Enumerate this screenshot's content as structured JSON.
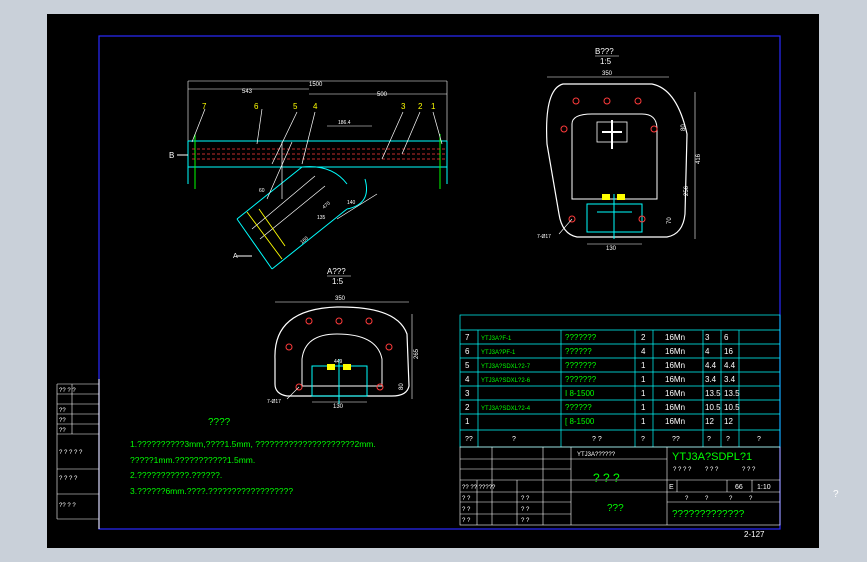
{
  "view_b": {
    "title": "B???",
    "scale": "1:5"
  },
  "view_a": {
    "title": "A???",
    "scale": "1:5"
  },
  "side_view": {
    "dims": {
      "d1500": "1500",
      "d543": "543",
      "d500": "500",
      "d186": "186.4",
      "d470": "470",
      "d135": "135",
      "d160": "160",
      "d140": "140",
      "d60": "60"
    },
    "callouts": [
      "7",
      "6",
      "5",
      "4",
      "3",
      "2",
      "1"
    ],
    "marker_b": "B",
    "marker_a": "A"
  },
  "b_view_dims": {
    "w350": "350",
    "h80": "80",
    "h416": "416",
    "h256": "256",
    "h70": "70",
    "w130": "130",
    "holes": "7-Ø17"
  },
  "a_view_dims": {
    "w350": "350",
    "h265": "265",
    "h80": "80",
    "w130": "130",
    "w449": "449",
    "holes": "7-Ø17"
  },
  "notes": {
    "title": "????",
    "lines": [
      "1.??????????3mm,????1.5mm,    ?????????????????????2mm.",
      "  ?????1mm.???????????1.5mm.",
      "2.???????????.??????.",
      "3.??????6mm.????.??????????????????"
    ]
  },
  "left_strip": [
    "?? ? ?",
    "??",
    "??",
    "??",
    "? ? ? ? ?",
    "? ? ? ?",
    "?? ? ?"
  ],
  "bom": {
    "rows": [
      {
        "no": "7",
        "code": "YTJ3A?F-1",
        "name": "???????",
        "qty": "2",
        "mat": "16Mn",
        "w1": "3",
        "w2": "6"
      },
      {
        "no": "6",
        "code": "YTJ3A?PF-1",
        "name": "??????",
        "qty": "4",
        "mat": "16Mn",
        "w1": "4",
        "w2": "16"
      },
      {
        "no": "5",
        "code": "YTJ3A?SDXL?2-7",
        "name": "???????",
        "qty": "1",
        "mat": "16Mn",
        "w1": "4.4",
        "w2": "4.4"
      },
      {
        "no": "4",
        "code": "YTJ3A?SDXL?2-6",
        "name": "???????",
        "qty": "1",
        "mat": "16Mn",
        "w1": "3.4",
        "w2": "3.4"
      },
      {
        "no": "3",
        "code": "",
        "name": "I 8-1500",
        "qty": "1",
        "mat": "16Mn",
        "w1": "13.5",
        "w2": "13.5"
      },
      {
        "no": "2",
        "code": "YTJ3A?SDXL?2-4",
        "name": "??????",
        "qty": "1",
        "mat": "16Mn",
        "w1": "10.5",
        "w2": "10.5"
      },
      {
        "no": "1",
        "code": "",
        "name": "[ 8-1500",
        "qty": "1",
        "mat": "16Mn",
        "w1": "12",
        "w2": "12"
      }
    ],
    "header": [
      "??",
      "?",
      "? ?",
      "?",
      "??",
      "?",
      "?",
      "?"
    ]
  },
  "title_block": {
    "top_label": "YTJ3A??????",
    "drawing_no": "YTJ3A?SDPL?1",
    "center_title": "? ? ?",
    "company": "???",
    "bottom_name": "?????????????",
    "stage": "E",
    "weight": "66",
    "scale": "1:10",
    "sheet_labels": [
      "?",
      "?",
      "?",
      "?"
    ],
    "row_labels": [
      "?? ?? ?????",
      "? ?",
      "? ?",
      "? ?"
    ],
    "small_cells": [
      "? ?",
      "? ?",
      "? ?"
    ],
    "header_cells": [
      "? ? ? ?",
      "? ? ?",
      "? ? ?"
    ]
  },
  "sheet_no": "2-127",
  "outside_mark": "?"
}
